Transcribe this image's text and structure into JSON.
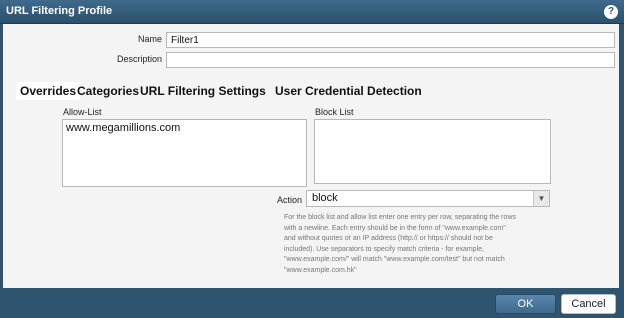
{
  "window": {
    "title": "URL Filtering Profile",
    "help_glyph": "?"
  },
  "form": {
    "name_label": "Name",
    "name_value": "Filter1",
    "description_label": "Description",
    "description_value": ""
  },
  "tabs": [
    {
      "label": "Overrides",
      "active": true
    },
    {
      "label": "Categories"
    },
    {
      "label": "URL Filtering Settings"
    },
    {
      "label": "User Credential Detection"
    }
  ],
  "allow_list": {
    "label": "Allow-List",
    "entries": [
      "www.megamillions.com"
    ]
  },
  "block_list": {
    "label": "Block List",
    "entries": []
  },
  "action": {
    "label": "Action",
    "selected": "block",
    "arrow_glyph": "▼"
  },
  "help_text": [
    "For the block list and allow list enter one entry per row, separating the rows",
    "with a newline. Each entry should be in the form of \"www.example.com\"",
    "and without quotes or an IP address (http:// or https:// should not be",
    "included). Use separators to specify match criteria - for example,",
    "\"www.example.com/\" will match \"www.example.com/test\" but not match",
    "\"www.example.com.hk\""
  ],
  "buttons": {
    "ok": "OK",
    "cancel": "Cancel"
  }
}
